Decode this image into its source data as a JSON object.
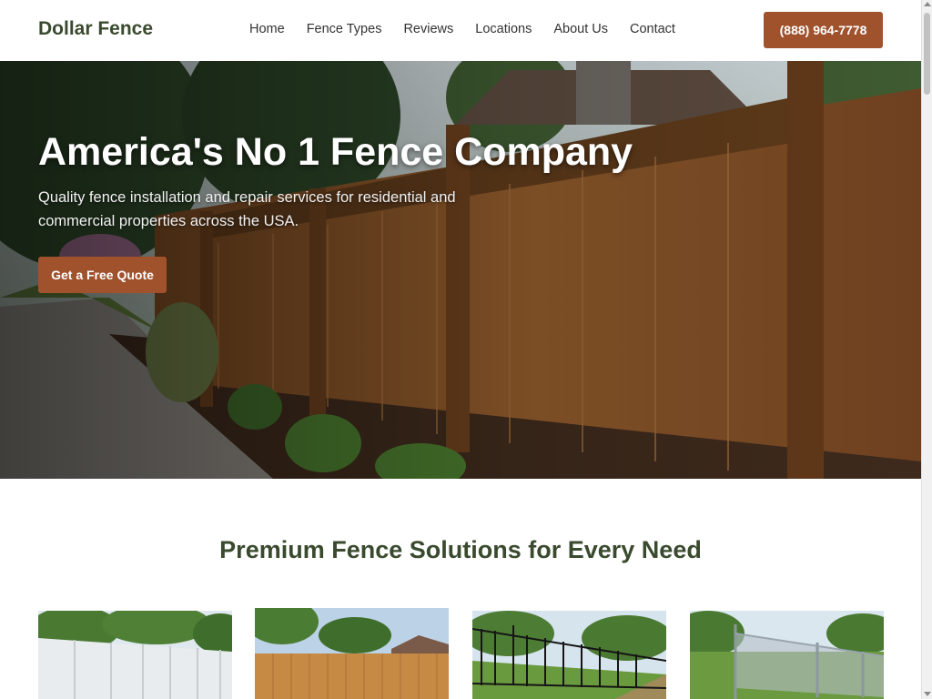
{
  "header": {
    "logo": "Dollar Fence",
    "nav": [
      "Home",
      "Fence Types",
      "Reviews",
      "Locations",
      "About Us",
      "Contact"
    ],
    "phone": "(888) 964-7778"
  },
  "hero": {
    "title": "America's No 1 Fence Company",
    "subtitle": "Quality fence installation and repair services for residential and commercial properties across the USA.",
    "cta": "Get a Free Quote"
  },
  "section": {
    "title": "Premium Fence Solutions for Every Need"
  },
  "colors": {
    "brand": "#a0522d",
    "heading": "#3a4a2e"
  },
  "cards": [
    {
      "image": "white-vinyl-fence-image"
    },
    {
      "image": "wood-privacy-fence-image"
    },
    {
      "image": "black-aluminum-fence-image"
    },
    {
      "image": "chain-link-fence-image"
    }
  ]
}
